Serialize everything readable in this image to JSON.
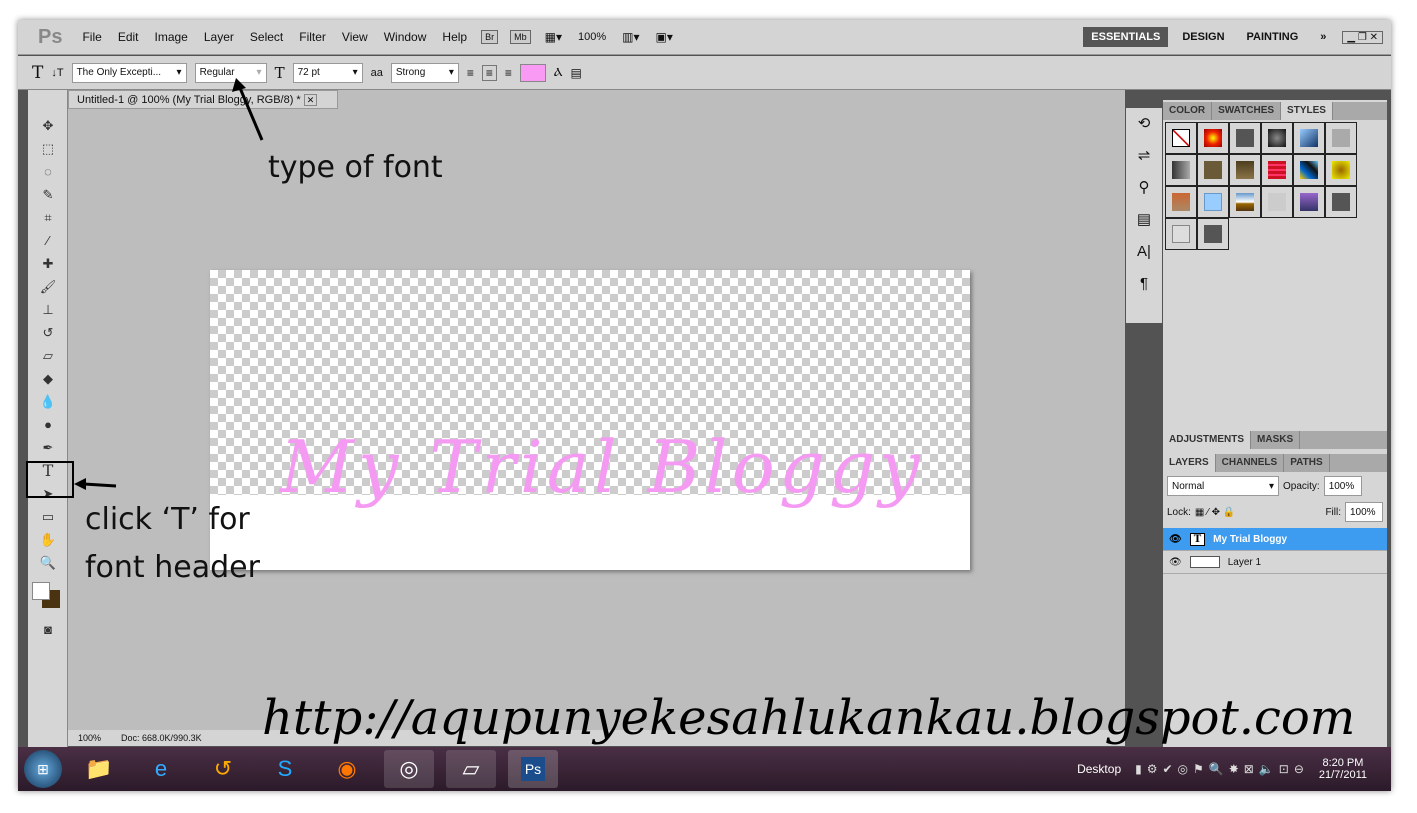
{
  "menu": {
    "items": [
      "File",
      "Edit",
      "Image",
      "Layer",
      "Select",
      "Filter",
      "View",
      "Window",
      "Help"
    ],
    "bridge": "Br",
    "minibridge": "Mb",
    "zoom": "100%",
    "workspaces": [
      "ESSENTIALS",
      "DESIGN",
      "PAINTING"
    ],
    "more": "»"
  },
  "options": {
    "tool": "T",
    "font_family": "The Only Excepti...",
    "font_style": "Regular",
    "font_size": "72 pt",
    "antialias_label": "aa",
    "antialias": "Strong",
    "text_color": "#f99af5"
  },
  "document": {
    "tab": "Untitled-1 @ 100% (My Trial Bloggy, RGB/8) *",
    "text": "My Trial Bloggy",
    "text_color": "#f59af2"
  },
  "status": {
    "zoom": "100%",
    "doc": "Doc: 668.0K/990.3K"
  },
  "panels": {
    "top_tabs": [
      "COLOR",
      "SWATCHES",
      "STYLES"
    ],
    "mid_tabs": [
      "ADJUSTMENTS",
      "MASKS"
    ],
    "layer_tabs": [
      "LAYERS",
      "CHANNELS",
      "PATHS"
    ],
    "blend_mode": "Normal",
    "opacity_label": "Opacity:",
    "opacity": "100%",
    "lock_label": "Lock:",
    "fill_label": "Fill:",
    "fill": "100%",
    "layers": [
      {
        "name": "My Trial Bloggy",
        "type": "text",
        "selected": true
      },
      {
        "name": "Layer 1",
        "type": "raster",
        "selected": false
      }
    ]
  },
  "annotations": {
    "font": "type of font",
    "tool_line1": "click ‘T’ for",
    "tool_line2": "font header",
    "url": "http://aqupunyekesahlukankau.blogspot.com"
  },
  "taskbar": {
    "desktop": "Desktop",
    "time": "8:20 PM",
    "date": "21/7/2011"
  }
}
